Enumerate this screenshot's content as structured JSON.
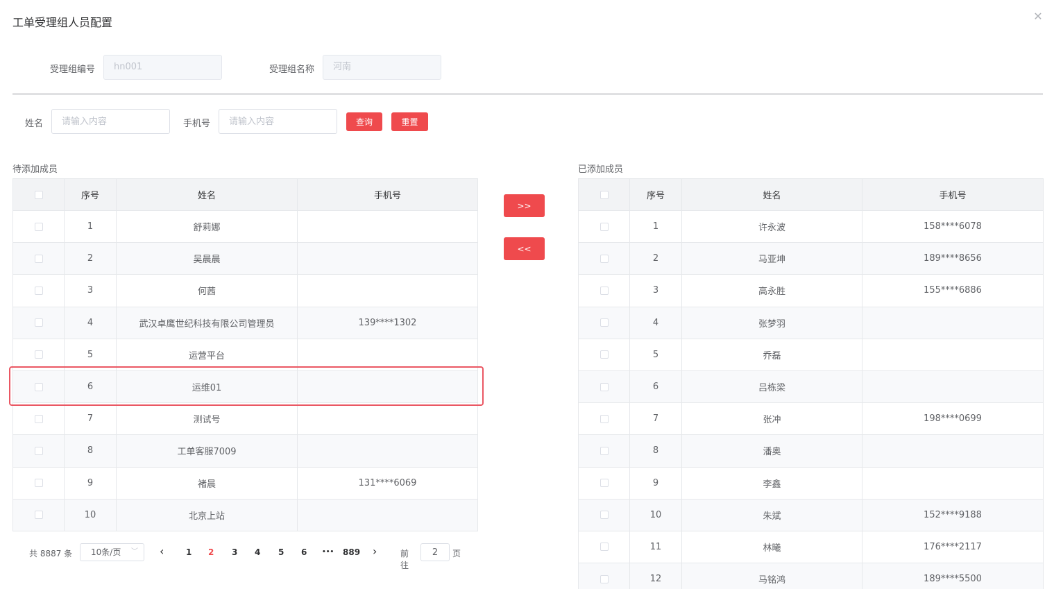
{
  "dialog": {
    "title": "工单受理组人员配置"
  },
  "group": {
    "code_label": "受理组编号",
    "code_value": "hn001",
    "name_label": "受理组名称",
    "name_value": "河南"
  },
  "search": {
    "name_label": "姓名",
    "name_placeholder": "请输入内容",
    "phone_label": "手机号",
    "phone_placeholder": "请输入内容",
    "query_label": "查询",
    "reset_label": "重置"
  },
  "transfer": {
    "add_label": ">>",
    "remove_label": "<<"
  },
  "pending": {
    "title": "待添加成员",
    "columns": [
      "序号",
      "姓名",
      "手机号"
    ],
    "rows": [
      {
        "index": "1",
        "name": "舒莉娜",
        "phone": ""
      },
      {
        "index": "2",
        "name": "吴晨晨",
        "phone": ""
      },
      {
        "index": "3",
        "name": "何茜",
        "phone": ""
      },
      {
        "index": "4",
        "name": "武汉卓鹰世纪科技有限公司管理员",
        "phone": "139****1302"
      },
      {
        "index": "5",
        "name": "运营平台",
        "phone": ""
      },
      {
        "index": "6",
        "name": "运维01",
        "phone": ""
      },
      {
        "index": "7",
        "name": "测试号",
        "phone": ""
      },
      {
        "index": "8",
        "name": "工单客服7009",
        "phone": ""
      },
      {
        "index": "9",
        "name": "褚晨",
        "phone": "131****6069"
      },
      {
        "index": "10",
        "name": "北京上站",
        "phone": ""
      }
    ]
  },
  "added": {
    "title": "已添加成员",
    "columns": [
      "序号",
      "姓名",
      "手机号"
    ],
    "rows": [
      {
        "index": "1",
        "name": "许永波",
        "phone": "158****6078"
      },
      {
        "index": "2",
        "name": "马亚坤",
        "phone": "189****8656"
      },
      {
        "index": "3",
        "name": "高永胜",
        "phone": "155****6886"
      },
      {
        "index": "4",
        "name": "张梦羽",
        "phone": ""
      },
      {
        "index": "5",
        "name": "乔磊",
        "phone": ""
      },
      {
        "index": "6",
        "name": "吕栋梁",
        "phone": ""
      },
      {
        "index": "7",
        "name": "张冲",
        "phone": "198****0699"
      },
      {
        "index": "8",
        "name": "潘奥",
        "phone": ""
      },
      {
        "index": "9",
        "name": "李鑫",
        "phone": ""
      },
      {
        "index": "10",
        "name": "朱斌",
        "phone": "152****9188"
      },
      {
        "index": "11",
        "name": "林曦",
        "phone": "176****2117"
      },
      {
        "index": "12",
        "name": "马铭鸿",
        "phone": "189****5500"
      }
    ]
  },
  "pagination": {
    "total_text": "共 8887 条",
    "page_size": "10条/页",
    "pages": [
      "1",
      "2",
      "3",
      "4",
      "5",
      "6",
      "•••",
      "889"
    ],
    "current_page": "2",
    "goto_prefix": "前往",
    "goto_value": "2",
    "goto_suffix": "页"
  },
  "icons": {
    "close": "close-icon",
    "prev": "chevron-left-icon",
    "next": "chevron-right-icon",
    "select": "chevron-down-icon"
  },
  "colors": {
    "primary": "#ef4a4d",
    "highlight": "#ea5763",
    "header_bg": "#f2f3f5"
  }
}
